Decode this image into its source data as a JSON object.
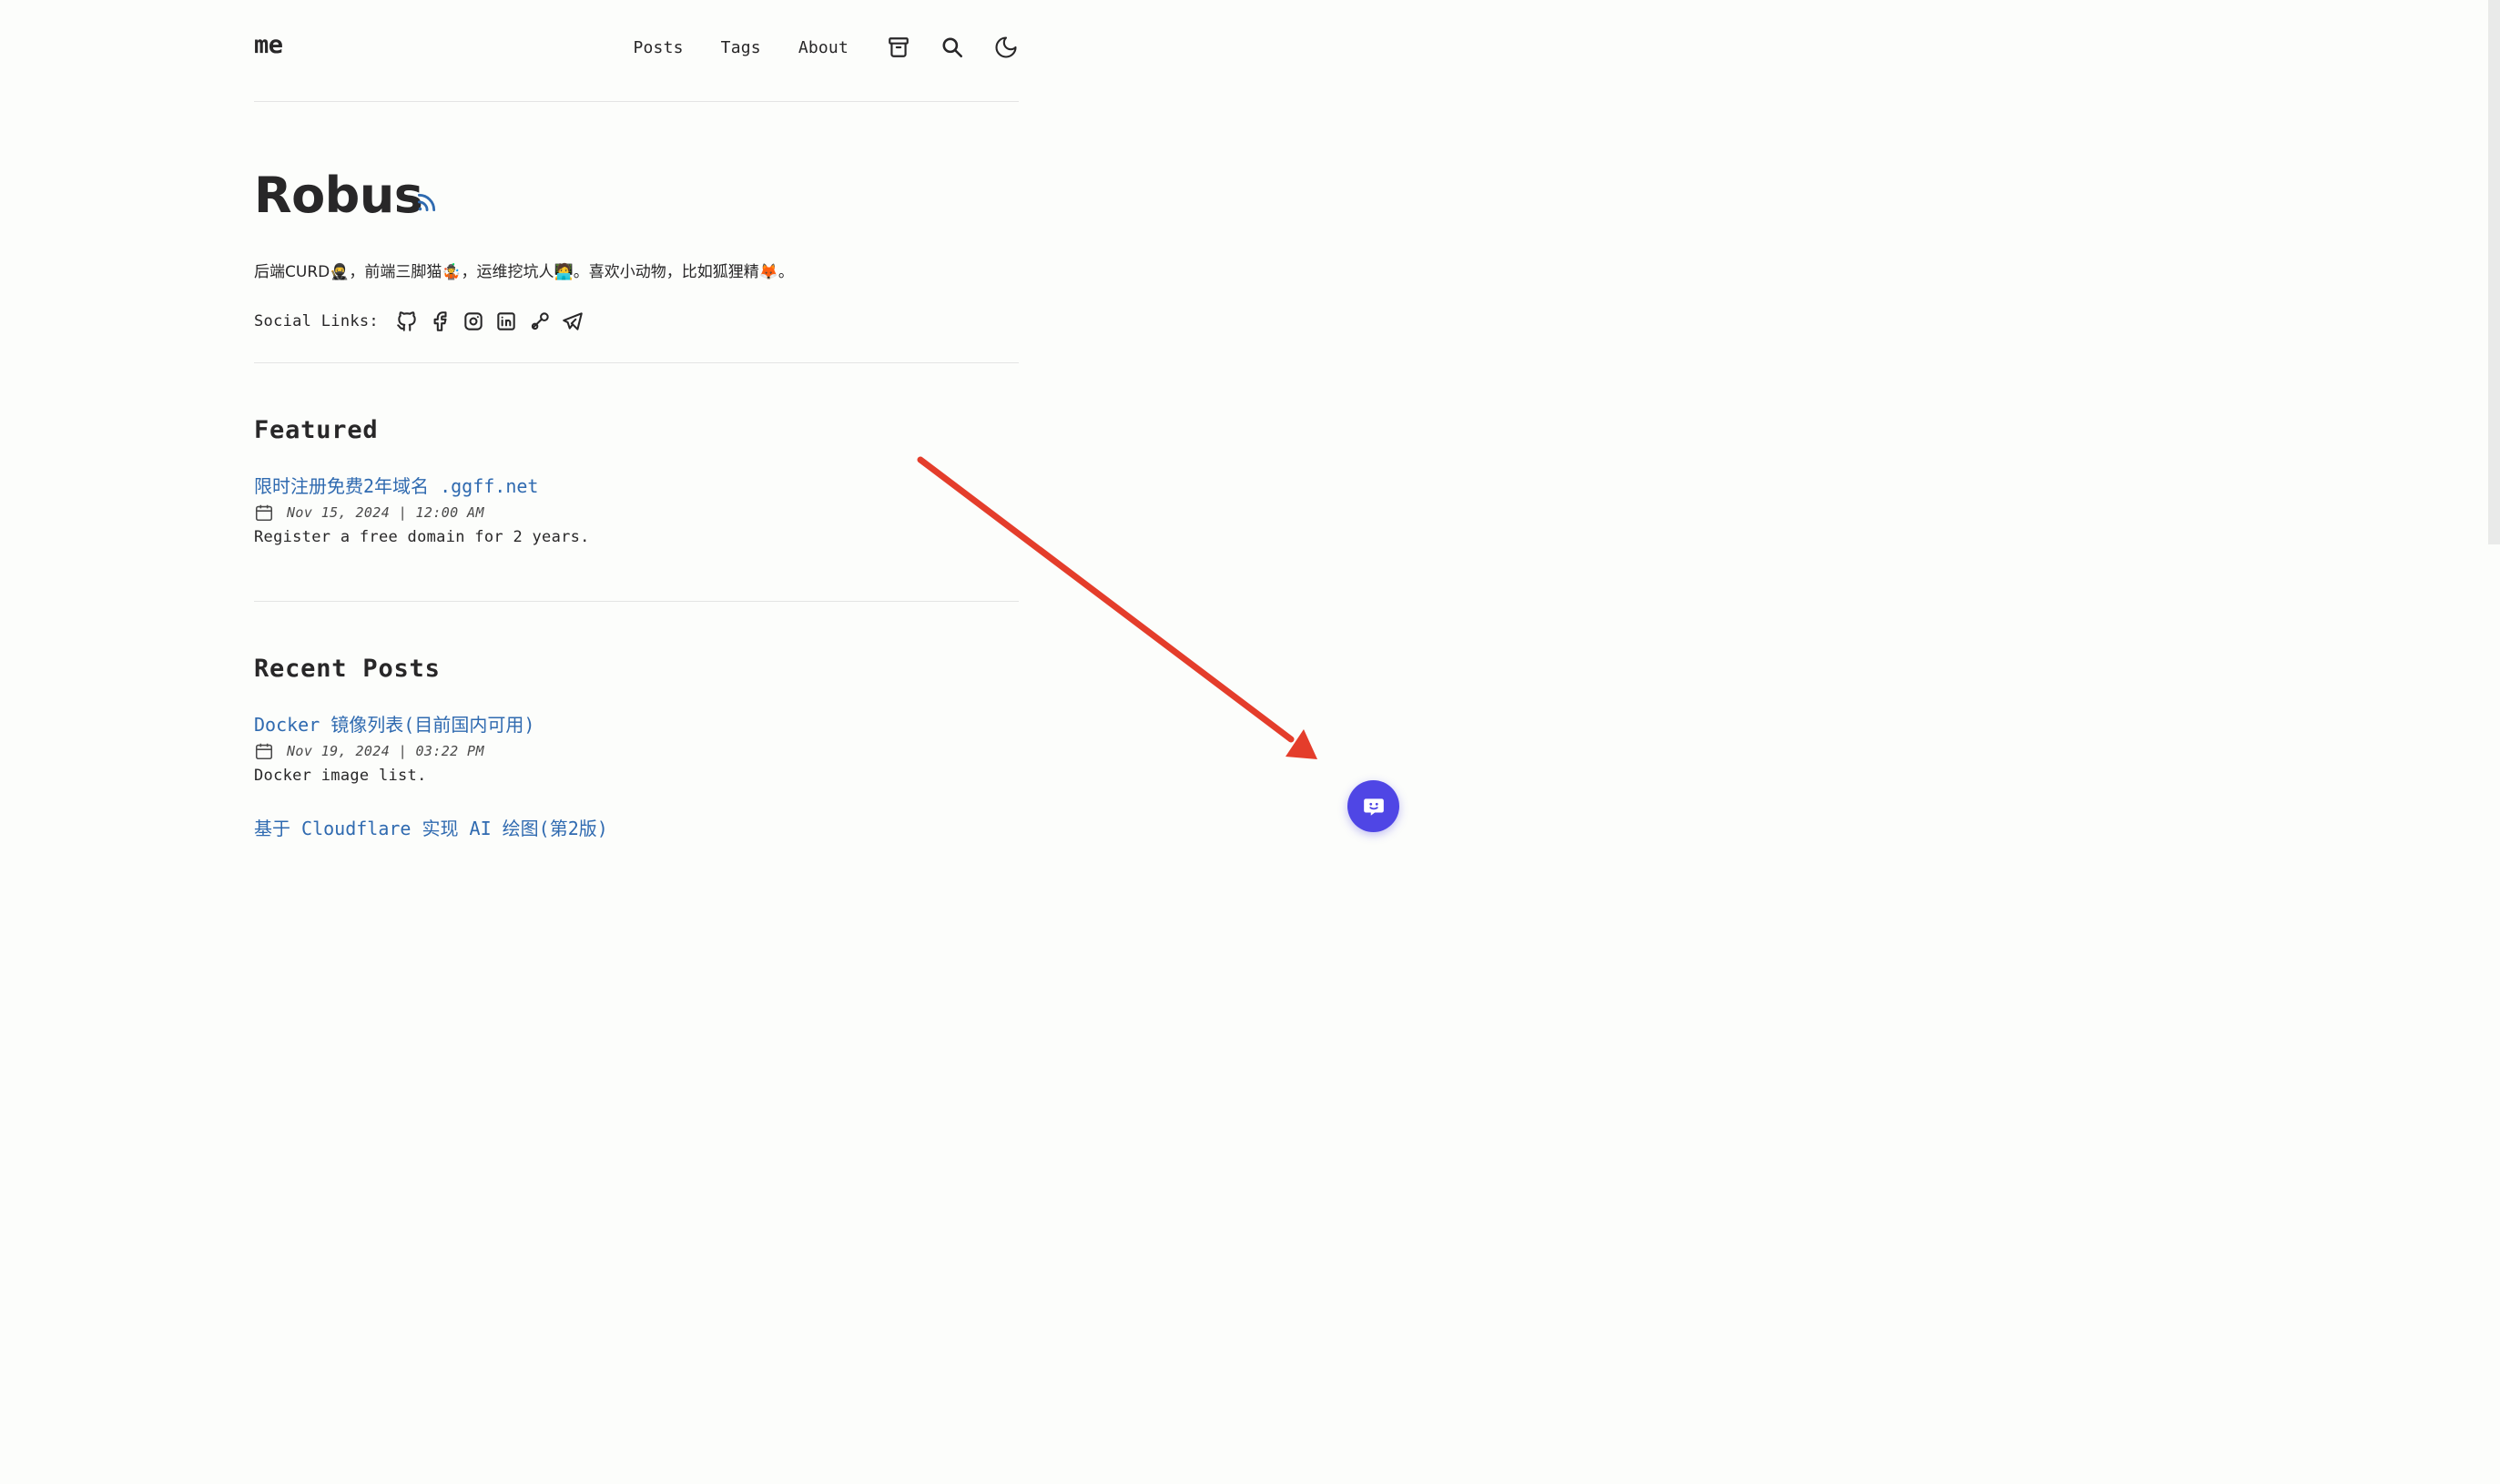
{
  "header": {
    "logo": "me",
    "nav": {
      "posts": "Posts",
      "tags": "Tags",
      "about": "About"
    },
    "icons": [
      "archive-icon",
      "search-icon",
      "moon-icon"
    ]
  },
  "hero": {
    "title": "Robus",
    "intro": "后端CURD🥷，前端三脚猫🤹，运维挖坑人🧑‍💻。喜欢小动物，比如狐狸精🦊。",
    "social_label": "Social Links:",
    "social_icons": [
      "github-icon",
      "facebook-icon",
      "instagram-icon",
      "linkedin-icon",
      "steam-icon",
      "telegram-icon"
    ]
  },
  "featured": {
    "title": "Featured",
    "posts": [
      {
        "title": "限时注册免费2年域名 .ggff.net",
        "date": "Nov 15, 2024 | 12:00 AM",
        "description": "Register a free domain for 2 years."
      }
    ]
  },
  "recent": {
    "title": "Recent Posts",
    "posts": [
      {
        "title": "Docker 镜像列表(目前国内可用)",
        "date": "Nov 19, 2024 | 03:22 PM",
        "description": "Docker image list."
      },
      {
        "title": "基于 Cloudflare 实现 AI 绘图(第2版)"
      }
    ]
  },
  "colors": {
    "link": "#2f6ab0",
    "text": "#282728",
    "background": "#fcfdfb",
    "chat_button": "#4f46e5",
    "annotation_arrow": "#e43d2b",
    "rss": "#2f6ab0"
  }
}
